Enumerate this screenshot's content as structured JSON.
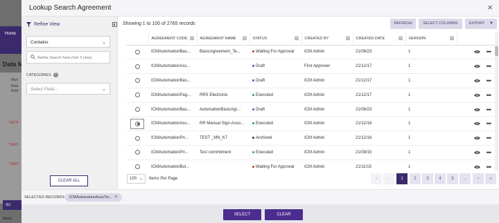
{
  "background": {
    "nav_home": "Home",
    "data_heading": "Data M",
    "side_texts": [
      "Man",
      "Note",
      "Note"
    ],
    "act_labels": [
      "* ACTI",
      "* ENTI",
      "* ENTI"
    ],
    "submit_label": "SU",
    "about_label": "About"
  },
  "modal": {
    "title": "Lookup Search Agreement",
    "close_label": "×"
  },
  "filter": {
    "title": "Refine View",
    "operator_value": "Contains",
    "search_placeholder": "Refine Search here (min 3 char)",
    "categories_label": "CATEGORIES",
    "field_placeholder": "Select Field...",
    "clear_all_label": "CLEAR ALL"
  },
  "toolbar": {
    "showing_text": "Showing 1 to 100 of 2765 records",
    "refresh_label": "REFRESH",
    "select_columns_label": "SELECT COLUMNS",
    "export_label": "EXPORT"
  },
  "table": {
    "columns": [
      "",
      "AGREEMENT CODE",
      "AGREEMENT NAME",
      "STATUS",
      "CREATED BY",
      "CREATED DATE",
      "VERSION",
      ""
    ],
    "rows": [
      {
        "code": "ICMAutomationBas...",
        "name": "BasicAgreement_Te...",
        "status": "Waiting For Approval",
        "status_color": "#c0392b",
        "created_by": "ICM Admin",
        "created_date": "21/06/23",
        "version": "1",
        "selected": false
      },
      {
        "code": "ICMAutomationAss...",
        "name": "",
        "status": "Draft",
        "status_color": "#7b3fb0",
        "created_by": "First Approver",
        "created_date": "21/12/17",
        "version": "1",
        "selected": false
      },
      {
        "code": "ICMAutomationBas...",
        "name": "",
        "status": "Draft",
        "status_color": "#7b3fb0",
        "created_by": "ICM Admin",
        "created_date": "21/12/17",
        "version": "1",
        "selected": false
      },
      {
        "code": "ICMAutomationPag...",
        "name": "RRS Electronic",
        "status": "Executed",
        "status_color": "#2e9e44",
        "created_by": "ICM Admin",
        "created_date": "21/12/17",
        "version": "1",
        "selected": false
      },
      {
        "code": "ICMAutomationBas...",
        "name": "AutomationBasicAgr...",
        "status": "Draft",
        "status_color": "#7b3fb0",
        "created_by": "ICM Admin",
        "created_date": "21/06/23",
        "version": "1",
        "selected": false
      },
      {
        "code": "ICMAutomationAss...",
        "name": "RR Manual Sign-Asso...",
        "status": "Executed",
        "status_color": "#2e9e44",
        "created_by": "ICM Admin",
        "created_date": "21/12/16",
        "version": "1",
        "selected": true
      },
      {
        "code": "ICMAutomationPri...",
        "name": "TEST _MN_K7",
        "status": "Archived",
        "status_color": "#333333",
        "created_by": "ICM Admin",
        "created_date": "21/12/16",
        "version": "1",
        "selected": false
      },
      {
        "code": "ICMAutomationPri...",
        "name": "Test commitment",
        "status": "Executed",
        "status_color": "#2e9e44",
        "created_by": "ICM Admin",
        "created_date": "21/09/15",
        "version": "1",
        "selected": false
      },
      {
        "code": "ICMAutomationBul...",
        "name": "",
        "status": "Waiting For Approval",
        "status_color": "#c0392b",
        "created_by": "ICM Admin",
        "created_date": "21/11/15",
        "version": "1",
        "selected": false
      }
    ]
  },
  "pagination": {
    "per_page_value": "100",
    "per_page_label": "Items Per Page",
    "first": "«",
    "prev": "‹",
    "pages": [
      "1",
      "2",
      "3",
      "4",
      "5"
    ],
    "ellipsis": "...",
    "next": "›",
    "last": "»",
    "current": "1"
  },
  "selected": {
    "label": "SELECTED RECORDS",
    "chip_text": "ICMAutomationAssoTw...",
    "chip_remove": "×"
  },
  "footer": {
    "select_label": "SELECT",
    "clear_label": "CLEAR"
  },
  "colors": {
    "primary": "#4b2d8f",
    "accent_light": "#dcd8ea",
    "executed": "#2e9e44",
    "draft": "#7b3fb0",
    "waiting": "#c0392b"
  }
}
